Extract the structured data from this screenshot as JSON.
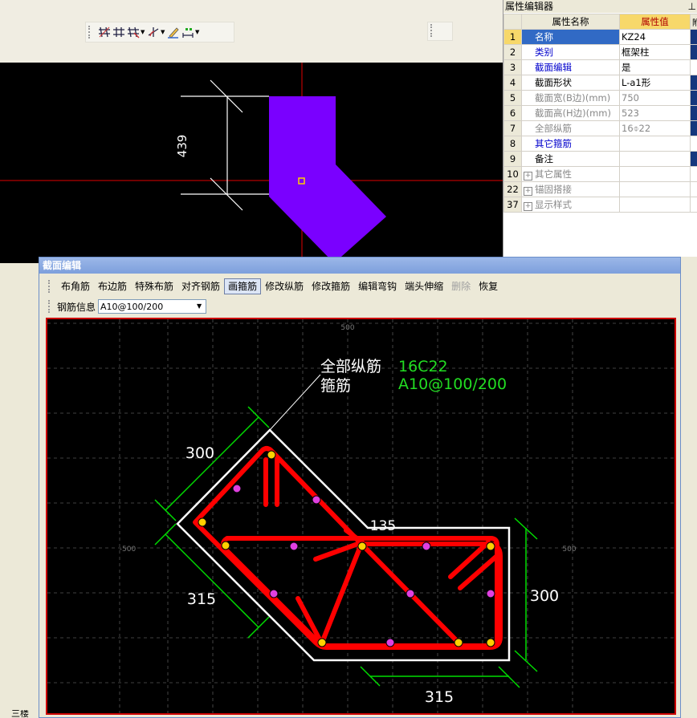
{
  "property_panel": {
    "title": "属性编辑器",
    "pin_icon": "pin-icon",
    "header_name": "属性名称",
    "header_value": "属性值",
    "header_extra": "附",
    "rows": [
      {
        "num": "1",
        "name": "名称",
        "value": "KZ24"
      },
      {
        "num": "2",
        "name": "类别",
        "value": "框架柱"
      },
      {
        "num": "3",
        "name": "截面编辑",
        "value": "是"
      },
      {
        "num": "4",
        "name": "截面形状",
        "value": "L-a1形"
      },
      {
        "num": "5",
        "name": "截面宽(B边)(mm)",
        "value": "750"
      },
      {
        "num": "6",
        "name": "截面高(H边)(mm)",
        "value": "523"
      },
      {
        "num": "7",
        "name": "全部纵筋",
        "value": "16⌽22"
      },
      {
        "num": "8",
        "name": "其它箍筋",
        "value": ""
      },
      {
        "num": "9",
        "name": "备注",
        "value": ""
      },
      {
        "num": "10",
        "name": "其它属性",
        "value": ""
      },
      {
        "num": "22",
        "name": "锚固搭接",
        "value": ""
      },
      {
        "num": "37",
        "name": "显示样式",
        "value": ""
      }
    ]
  },
  "main_canvas": {
    "dimension_label": "439",
    "shape_color": "#7a00ff",
    "crosshair_color": "#e00000"
  },
  "dialog": {
    "title": "截面编辑",
    "toolbar": [
      "布角筋",
      "布边筋",
      "特殊布筋",
      "对齐钢筋",
      "画箍筋",
      "修改纵筋",
      "修改箍筋",
      "编辑弯钩",
      "端头伸缩",
      "删除",
      "恢复"
    ],
    "active_tool": "画箍筋",
    "disabled_tool": "删除",
    "rebar_info_label": "钢筋信息",
    "rebar_info_value": "A10@100/200",
    "canvas": {
      "label_all_longitudinal": "全部纵筋",
      "label_stirrup": "箍筋",
      "value_all_longitudinal": "16C22",
      "value_stirrup": "A10@100/200",
      "dim_top_left": "300",
      "dim_bottom_left": "315",
      "dim_right": "300",
      "dim_bottom": "315",
      "angle_label": "135",
      "axis_top": "500",
      "axis_left": "-500",
      "axis_right": "500",
      "label_color": "#ffffff",
      "value_color": "#22dd22",
      "stirrup_color": "#ff0000",
      "outline_color": "#ffffff",
      "dim_color": "#00dd00"
    }
  },
  "bottom_left_text": "三楼"
}
